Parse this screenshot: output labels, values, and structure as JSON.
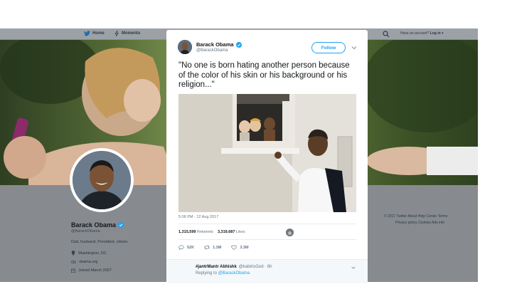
{
  "nav": {
    "home_label": "Home",
    "moments_label": "Moments",
    "account_text": "Have an account?",
    "login_label": "Log in"
  },
  "profile": {
    "name": "Barack Obama",
    "handle": "@BarackObama",
    "bio": "Dad, husband, President, citizen.",
    "location": "Washington, DC",
    "website": "obama.org",
    "joined": "Joined March 2007"
  },
  "footer": {
    "line1": "© 2017 Twitter   About   Help Center   Terms",
    "line2": "Privacy policy   Cookies   Ads info"
  },
  "tweet": {
    "name": "Barack Obama",
    "handle": "@BarackObama",
    "follow_label": "Follow",
    "text": "\"No one is born hating another person because of the color of his skin or his background or his religion...\"",
    "timestamp": "5:06 PM - 12 Aug 2017",
    "retweets_count": "1,315,599",
    "retweets_label": "Retweets",
    "likes_count": "3,319,687",
    "likes_label": "Likes",
    "reply_count": "52K",
    "retweet_action_count": "1.3M",
    "like_action_count": "3.3M"
  },
  "reply": {
    "name": "#jantrMantr Abhishk",
    "handle_time": "@kabirisGod · 8h",
    "replying_prefix": "Replying to",
    "replying_to": "@BarackObama"
  },
  "colors": {
    "brand_blue": "#1da1f2",
    "verified_blue": "#1da1f2",
    "text_primary": "#14171a",
    "text_secondary": "#657786"
  }
}
